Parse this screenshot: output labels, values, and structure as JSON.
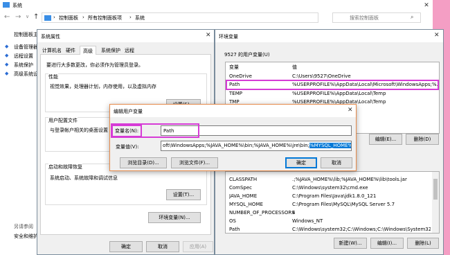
{
  "explorer": {
    "title": "系统",
    "breadcrumb": [
      "控制面板",
      "所有控制面板项",
      "系统"
    ],
    "search_placeholder": "搜索控制面板",
    "sidebar_header": "控制面板主",
    "sidebar_items": [
      "设备管理器",
      "远程设置",
      "系统保护",
      "高级系统设"
    ],
    "see_also": "另请参阅",
    "security": "安全和维护"
  },
  "sysprops": {
    "title": "系统属性",
    "tabs": [
      "计算机名",
      "硬件",
      "高级",
      "系统保护",
      "远程"
    ],
    "active_tab": 2,
    "intro": "要进行大多数更改，你必须作为管理员登录。",
    "perf_title": "性能",
    "perf_desc": "视觉效果，处理器计划，内存使用，以及虚拟内存",
    "perf_btn": "设置(S)...",
    "profile_title": "用户配置文件",
    "profile_desc": "与登录帐户相关的桌面设置",
    "startup_title": "启动和故障恢复",
    "startup_desc": "系统启动、系统故障和调试信息",
    "startup_btn": "设置(T)...",
    "envvars_btn": "环境变量(N)...",
    "ok": "确定",
    "cancel": "取消",
    "apply": "应用(A)"
  },
  "envwin": {
    "title": "环境变量",
    "user_vars_label": "9527 的用户变量(U)",
    "col_var": "变量",
    "col_val": "值",
    "user_vars": [
      {
        "name": "OneDrive",
        "value": "C:\\Users\\9527\\OneDrive"
      },
      {
        "name": "Path",
        "value": "%USERPROFILE%\\AppData\\Local\\Microsoft\\WindowsApps;%..."
      },
      {
        "name": "TEMP",
        "value": "%USERPROFILE%\\AppData\\Local\\Temp"
      },
      {
        "name": "TMP",
        "value": "%USERPROFILE%\\AppData\\Local\\Temp"
      }
    ],
    "edit_btn": "编辑(E)...",
    "delete_btn": "删除(D)",
    "sys_vars": [
      {
        "name": "CLASSPATH",
        "value": ".;%JAVA_HOME%\\lib;%JAVA_HOME%\\lib\\tools.jar"
      },
      {
        "name": "ComSpec",
        "value": "C:\\Windows\\system32\\cmd.exe"
      },
      {
        "name": "JAVA_HOME",
        "value": "C:\\Program Files\\Java\\jdk1.8.0_121"
      },
      {
        "name": "MYSQL_HOME",
        "value": "C:\\Program Files\\MySQL\\MySQL Server 5.7"
      },
      {
        "name": "NUMBER_OF_PROCESSORS",
        "value": "4"
      },
      {
        "name": "OS",
        "value": "Windows_NT"
      },
      {
        "name": "Path",
        "value": "C:\\Windows\\system32;C:\\Windows;C:\\Windows\\System32\\Wb..."
      }
    ],
    "new_btn": "新建(W)...",
    "edit2_btn": "编辑(I)...",
    "delete2_btn": "删除(L)"
  },
  "editdlg": {
    "title": "编辑用户变量",
    "name_label": "变量名(N):",
    "name_value": "Path",
    "value_label": "变量值(V):",
    "value_plain": "oft\\WindowsApps;%JAVA_HOME%\\bin;%JAVA_HOME%\\jre\\bin;",
    "value_selected": "%MYSQL_HOME%\\bin;",
    "browse_dir": "浏览目录(D)...",
    "browse_file": "浏览文件(F)...",
    "ok": "确定",
    "cancel": "取消"
  },
  "colors": {
    "highlight_outline": "#d63bd6",
    "selection": "#0078d7",
    "background": "#f49ec4"
  }
}
